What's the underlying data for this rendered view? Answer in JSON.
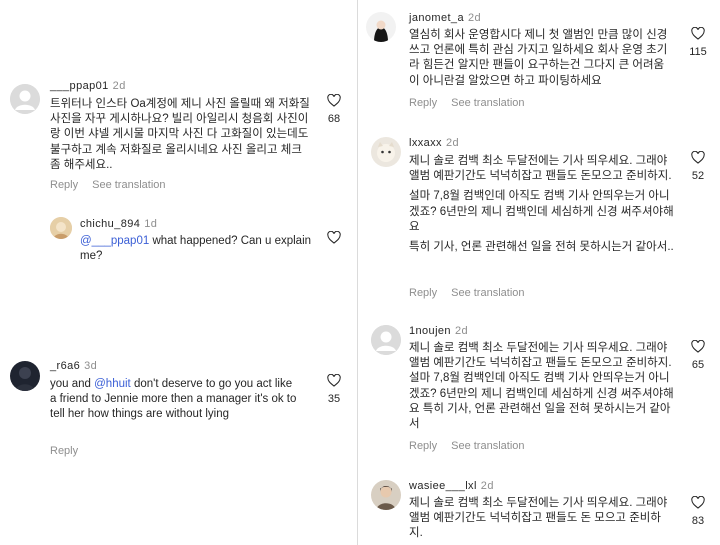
{
  "left": {
    "comments": [
      {
        "username": "___ppap01",
        "time": "2d",
        "text": "트위터나 인스타 Oa계정에 제니 사진 올릴때 왜 저화질 사진을 자꾸 게시하나요? 빌리 아일리시 청음회 사진이랑 이번 샤넬 게시물 마지막 사진 다 고화질이 있는데도 불구하고 계속 저화질로 올리시네요 사진 올리고 체크좀 해주세요..",
        "reply": "Reply",
        "see_translation": "See translation",
        "likes": "68"
      },
      {
        "username": "chichu_894",
        "time": "1d",
        "mention": "@___ppap01",
        "text": " what happened? Can u explain me?"
      },
      {
        "username": "_r6a6",
        "time": "3d",
        "text_pre": "you and ",
        "mention": "@hhuit",
        "text": " don't deserve to go you act like a friend to Jennie more then a manager it's ok to tell her how things are without lying",
        "reply": "Reply",
        "likes": "35"
      }
    ]
  },
  "right": {
    "comments": [
      {
        "username": "janomet_a",
        "time": "2d",
        "text": "열심히 회사 운영합시다 제니 첫 앨범인 만큼 많이 신경쓰고 언론에 특히 관심 가지고 일하세요 회사 운영 초기라 힘든건 알지만 팬들이 요구하는건 그다지 큰 어려움이 아니란걸 알았으면 하고 파이팅하세요",
        "reply": "Reply",
        "see_translation": "See translation",
        "likes": "115"
      },
      {
        "username": "lxxaxx",
        "time": "2d",
        "p1": "제니 솔로 컴백 최소 두달전에는 기사 띄우세요. 그래야 앨범 예판기간도 넉넉히잡고 팬들도 돈모으고 준비하지.",
        "p2": "설마 7,8월 컴백인데 아직도 컴백 기사 안띄우는거 아니겠죠? 6년만의 제니 컴백인데 세심하게 신경 써주셔야해요",
        "p3": "특히 기사, 언론 관련해선 일을 전혀 못하시는거 같아서..",
        "reply": "Reply",
        "see_translation": "See translation",
        "likes": "52"
      },
      {
        "username": "1noujen",
        "time": "2d",
        "text": "제니 솔로 컴백 최소 두달전에는 기사 띄우세요. 그래야 앨범 예판기간도 넉넉히잡고 팬들도 돈모으고 준비하지. 설마 7,8월 컴백인데 아직도 컴백 기사 안띄우는거 아니겠죠? 6년만의 제니 컴백인데 세심하게 신경 써주셔야해요 특히 기사, 언론 관련해선 일을 전혀 못하시는거 같아서",
        "reply": "Reply",
        "see_translation": "See translation",
        "likes": "65"
      },
      {
        "username": "wasiee___lxl",
        "time": "2d",
        "text": "제니 솔로 컴백 최소 두달전에는 기사 띄우세요. 그래야 앨범 예판기간도 넉넉히잡고 팬들도 돈 모으고 준비하지.",
        "likes": "83"
      }
    ]
  },
  "icons": {
    "like": "heart-icon",
    "default_avatar": "default-avatar-icon"
  },
  "colors": {
    "mention": "#3b5fd6",
    "meta": "#8e8e8e",
    "text": "#262626"
  }
}
